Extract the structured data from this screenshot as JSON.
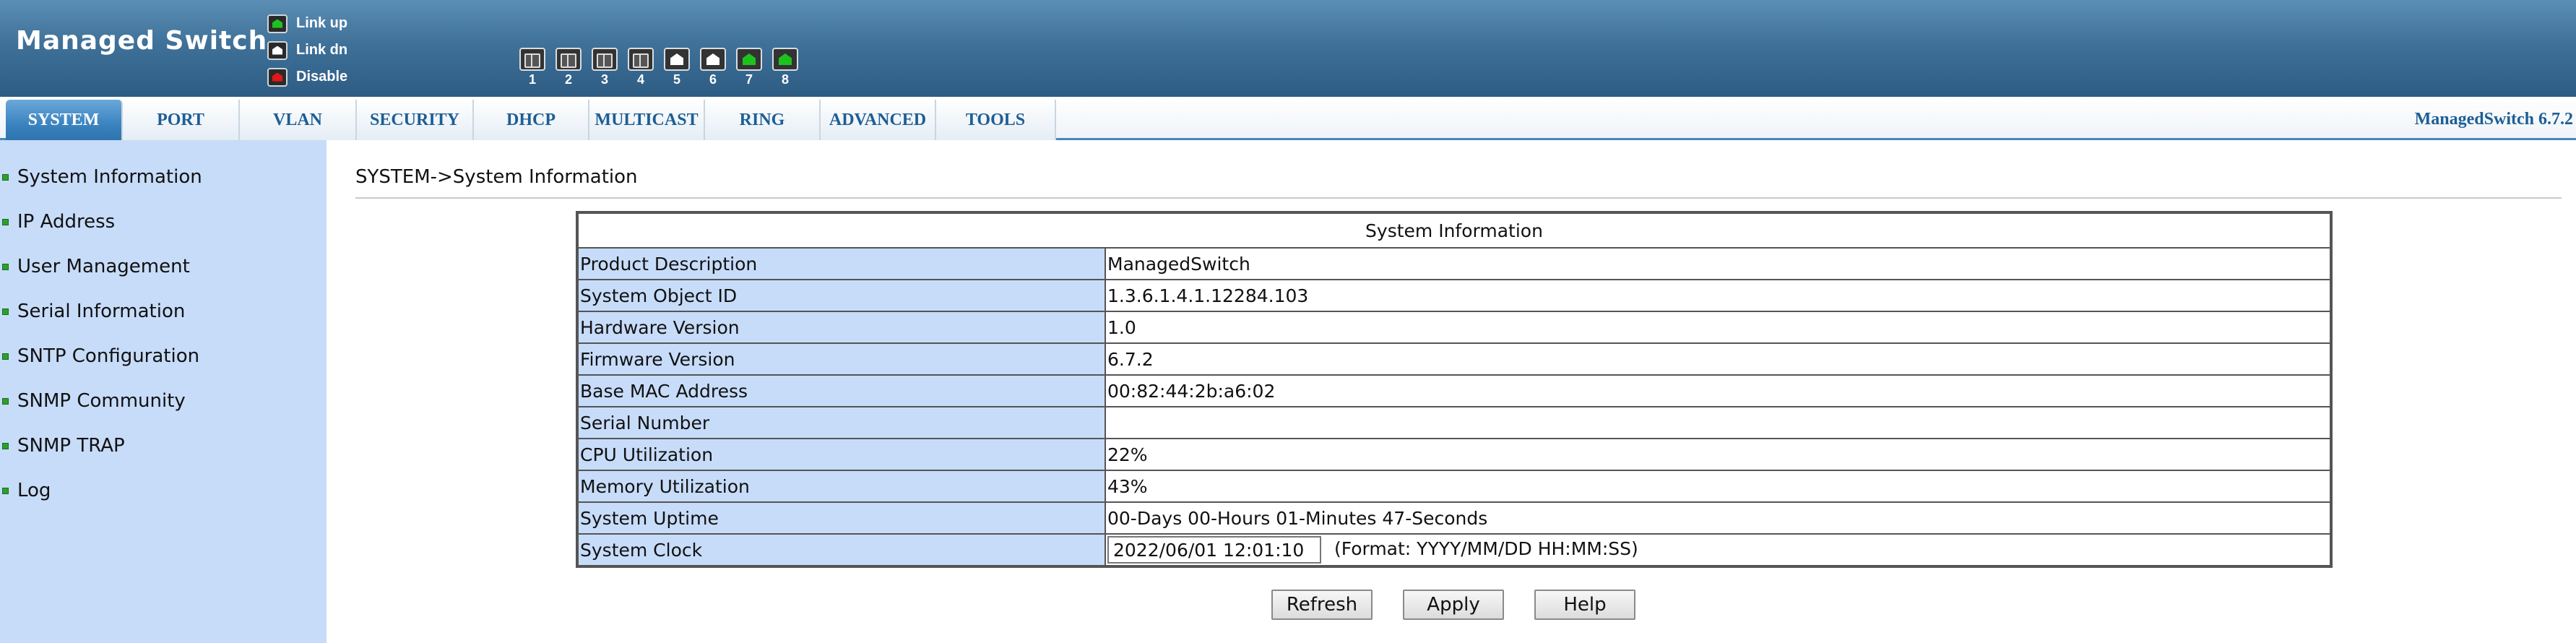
{
  "header": {
    "brand": "Managed Switch",
    "legend": [
      {
        "label": "Link up",
        "color": "#1ec21e"
      },
      {
        "label": "Link dn",
        "color": "#ffffff"
      },
      {
        "label": "Disable",
        "color": "#e01818"
      }
    ],
    "ports": [
      {
        "number": "1",
        "state": "empty"
      },
      {
        "number": "2",
        "state": "empty"
      },
      {
        "number": "3",
        "state": "empty"
      },
      {
        "number": "4",
        "state": "empty"
      },
      {
        "number": "5",
        "state": "link-dn"
      },
      {
        "number": "6",
        "state": "link-dn"
      },
      {
        "number": "7",
        "state": "link-up"
      },
      {
        "number": "8",
        "state": "link-up"
      }
    ]
  },
  "nav": {
    "tabs": [
      "SYSTEM",
      "PORT",
      "VLAN",
      "SECURITY",
      "DHCP",
      "MULTICAST",
      "RING",
      "ADVANCED",
      "TOOLS"
    ],
    "active_tab": "SYSTEM",
    "version": "ManagedSwitch 6.7.2"
  },
  "sidebar": {
    "items": [
      "System Information",
      "IP Address",
      "User Management",
      "Serial Information",
      "SNTP Configuration",
      "SNMP Community",
      "SNMP TRAP",
      "Log"
    ]
  },
  "main": {
    "breadcrumb": "SYSTEM->System Information",
    "table_title": "System Information",
    "rows": [
      {
        "label": "Product Description",
        "value": "ManagedSwitch"
      },
      {
        "label": "System Object ID",
        "value": "1.3.6.1.4.1.12284.103"
      },
      {
        "label": "Hardware Version",
        "value": "1.0"
      },
      {
        "label": "Firmware Version",
        "value": "6.7.2"
      },
      {
        "label": "Base MAC Address",
        "value": "00:82:44:2b:a6:02"
      },
      {
        "label": "Serial Number",
        "value": ""
      },
      {
        "label": "CPU Utilization",
        "value": "22%"
      },
      {
        "label": "Memory Utilization",
        "value": "43%"
      },
      {
        "label": "System Uptime",
        "value": "00-Days 00-Hours 01-Minutes 47-Seconds"
      }
    ],
    "clock": {
      "label": "System Clock",
      "value": "2022/06/01 12:01:10",
      "format_hint": "(Format: YYYY/MM/DD HH:MM:SS)"
    },
    "buttons": {
      "refresh": "Refresh",
      "apply": "Apply",
      "help": "Help"
    }
  }
}
